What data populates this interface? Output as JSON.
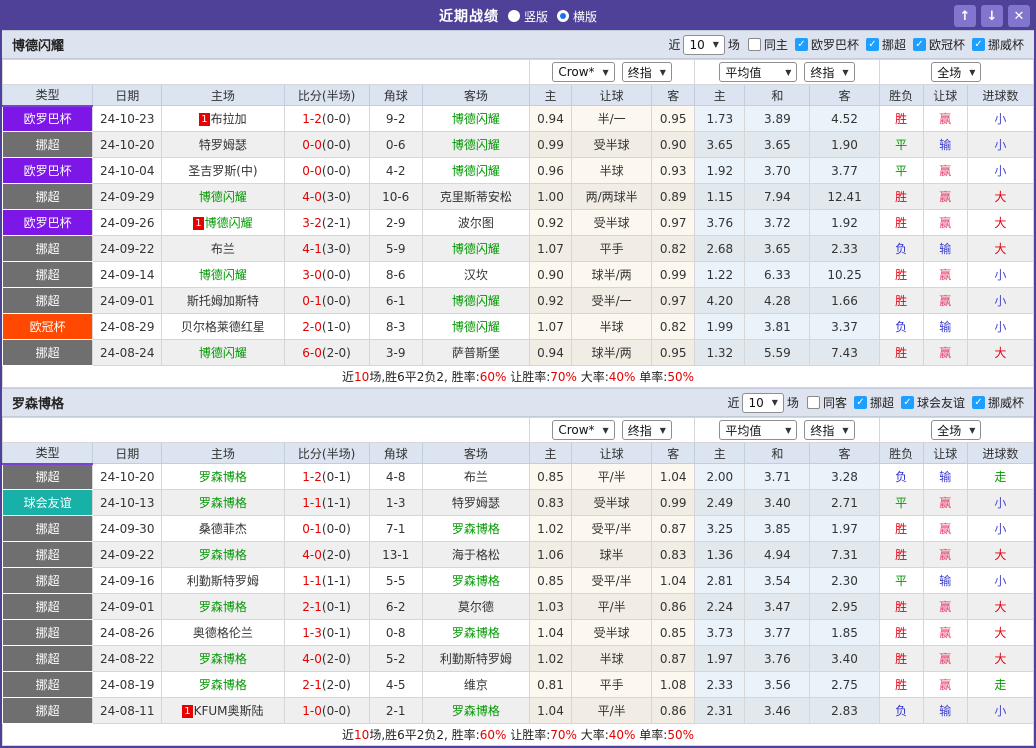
{
  "titlebar": {
    "title": "近期战绩",
    "radio_vertical": "竖版",
    "radio_horizontal": "横版",
    "selected_layout": "横版"
  },
  "icons": {
    "up": "↑",
    "down": "↓",
    "close": "✕",
    "check": "✓",
    "caret": "▼"
  },
  "colors": {
    "titlebar_bg": "#4e4197",
    "button_bg": "#8175ce",
    "checkbox_blue": "#1e9fff",
    "team_green": "#009900",
    "score_red": "#e60000"
  },
  "league_colors": {
    "欧罗巴杯": "#7d17e8",
    "挪超": "#6f6f6f",
    "欧冠杯": "#ff4800",
    "球会友谊": "#17b1a7"
  },
  "result_colors": {
    "胜": "#e60012",
    "平": "#009900",
    "负": "#2f2fd0",
    "赢": "#e83e6c",
    "输": "#3a3ad0",
    "大": "#e60012",
    "小": "#4a4ad0",
    "走": "#009900"
  },
  "columns": [
    "类型",
    "日期",
    "主场",
    "比分(半场)",
    "角球",
    "客场",
    "主",
    "让球",
    "客",
    "主",
    "和",
    "客",
    "胜负",
    "让球",
    "进球数"
  ],
  "dropdowns": {
    "crow": "Crow*",
    "crow_final": "终指",
    "avg": "平均值",
    "avg_final": "终指",
    "scope": "全场"
  },
  "sections": [
    {
      "team": "博德闪耀",
      "filters": {
        "near": "近",
        "count": "10",
        "games": "场",
        "same": {
          "label": "同主",
          "checked": false
        },
        "leagues": [
          "欧罗巴杯",
          "挪超",
          "欧冠杯",
          "挪威杯"
        ]
      },
      "rows": [
        {
          "league": "欧罗巴杯",
          "date": "24-10-23",
          "home": "布拉加",
          "home_rank": "1",
          "home_green": false,
          "score": "1-2",
          "half": "(0-0)",
          "corners": "9-2",
          "away": "博德闪耀",
          "away_green": true,
          "crow": [
            "0.94",
            "半/一",
            "0.95"
          ],
          "avg": [
            "1.73",
            "3.89",
            "4.52"
          ],
          "outcome": [
            "胜",
            "赢",
            "小"
          ]
        },
        {
          "league": "挪超",
          "date": "24-10-20",
          "home": "特罗姆瑟",
          "home_rank": "",
          "home_green": false,
          "score": "0-0",
          "half": "(0-0)",
          "corners": "0-6",
          "away": "博德闪耀",
          "away_green": true,
          "crow": [
            "0.99",
            "受半球",
            "0.90"
          ],
          "avg": [
            "3.65",
            "3.65",
            "1.90"
          ],
          "outcome": [
            "平",
            "输",
            "小"
          ]
        },
        {
          "league": "欧罗巴杯",
          "date": "24-10-04",
          "home": "圣吉罗斯(中)",
          "home_rank": "",
          "home_green": false,
          "score": "0-0",
          "half": "(0-0)",
          "corners": "4-2",
          "away": "博德闪耀",
          "away_green": true,
          "crow": [
            "0.96",
            "半球",
            "0.93"
          ],
          "avg": [
            "1.92",
            "3.70",
            "3.77"
          ],
          "outcome": [
            "平",
            "赢",
            "小"
          ]
        },
        {
          "league": "挪超",
          "date": "24-09-29",
          "home": "博德闪耀",
          "home_rank": "",
          "home_green": true,
          "score": "4-0",
          "half": "(3-0)",
          "corners": "10-6",
          "away": "克里斯蒂安松",
          "away_green": false,
          "crow": [
            "1.00",
            "两/两球半",
            "0.89"
          ],
          "avg": [
            "1.15",
            "7.94",
            "12.41"
          ],
          "outcome": [
            "胜",
            "赢",
            "大"
          ]
        },
        {
          "league": "欧罗巴杯",
          "date": "24-09-26",
          "home": "博德闪耀",
          "home_rank": "1",
          "home_green": true,
          "score": "3-2",
          "half": "(2-1)",
          "corners": "2-9",
          "away": "波尔图",
          "away_green": false,
          "crow": [
            "0.92",
            "受半球",
            "0.97"
          ],
          "avg": [
            "3.76",
            "3.72",
            "1.92"
          ],
          "outcome": [
            "胜",
            "赢",
            "大"
          ]
        },
        {
          "league": "挪超",
          "date": "24-09-22",
          "home": "布兰",
          "home_rank": "",
          "home_green": false,
          "score": "4-1",
          "half": "(3-0)",
          "corners": "5-9",
          "away": "博德闪耀",
          "away_green": true,
          "crow": [
            "1.07",
            "平手",
            "0.82"
          ],
          "avg": [
            "2.68",
            "3.65",
            "2.33"
          ],
          "outcome": [
            "负",
            "输",
            "大"
          ]
        },
        {
          "league": "挪超",
          "date": "24-09-14",
          "home": "博德闪耀",
          "home_rank": "",
          "home_green": true,
          "score": "3-0",
          "half": "(0-0)",
          "corners": "8-6",
          "away": "汉坎",
          "away_green": false,
          "crow": [
            "0.90",
            "球半/两",
            "0.99"
          ],
          "avg": [
            "1.22",
            "6.33",
            "10.25"
          ],
          "outcome": [
            "胜",
            "赢",
            "小"
          ]
        },
        {
          "league": "挪超",
          "date": "24-09-01",
          "home": "斯托姆加斯特",
          "home_rank": "",
          "home_green": false,
          "score": "0-1",
          "half": "(0-0)",
          "corners": "6-1",
          "away": "博德闪耀",
          "away_green": true,
          "crow": [
            "0.92",
            "受半/一",
            "0.97"
          ],
          "avg": [
            "4.20",
            "4.28",
            "1.66"
          ],
          "outcome": [
            "胜",
            "赢",
            "小"
          ]
        },
        {
          "league": "欧冠杯",
          "date": "24-08-29",
          "home": "贝尔格莱德红星",
          "home_rank": "",
          "home_green": false,
          "score": "2-0",
          "half": "(1-0)",
          "corners": "8-3",
          "away": "博德闪耀",
          "away_green": true,
          "crow": [
            "1.07",
            "半球",
            "0.82"
          ],
          "avg": [
            "1.99",
            "3.81",
            "3.37"
          ],
          "outcome": [
            "负",
            "输",
            "小"
          ]
        },
        {
          "league": "挪超",
          "date": "24-08-24",
          "home": "博德闪耀",
          "home_rank": "",
          "home_green": true,
          "score": "6-0",
          "half": "(2-0)",
          "corners": "3-9",
          "away": "萨普斯堡",
          "away_green": false,
          "crow": [
            "0.94",
            "球半/两",
            "0.95"
          ],
          "avg": [
            "1.32",
            "5.59",
            "7.43"
          ],
          "outcome": [
            "胜",
            "赢",
            "大"
          ]
        }
      ],
      "summary": [
        {
          "t": "近"
        },
        {
          "t": "10",
          "red": true
        },
        {
          "t": "场,胜6平2负2, 胜率:"
        },
        {
          "t": "60%",
          "red": true
        },
        {
          "t": " 让胜率:"
        },
        {
          "t": "70%",
          "red": true
        },
        {
          "t": " 大率:"
        },
        {
          "t": "40%",
          "red": true
        },
        {
          "t": " 单率:"
        },
        {
          "t": "50%",
          "red": true
        }
      ]
    },
    {
      "team": "罗森博格",
      "filters": {
        "near": "近",
        "count": "10",
        "games": "场",
        "same": {
          "label": "同客",
          "checked": false
        },
        "leagues": [
          "挪超",
          "球会友谊",
          "挪威杯"
        ]
      },
      "rows": [
        {
          "league": "挪超",
          "date": "24-10-20",
          "home": "罗森博格",
          "home_rank": "",
          "home_green": true,
          "score": "1-2",
          "half": "(0-1)",
          "corners": "4-8",
          "away": "布兰",
          "away_green": false,
          "crow": [
            "0.85",
            "平/半",
            "1.04"
          ],
          "avg": [
            "2.00",
            "3.71",
            "3.28"
          ],
          "outcome": [
            "负",
            "输",
            "走"
          ]
        },
        {
          "league": "球会友谊",
          "date": "24-10-13",
          "home": "罗森博格",
          "home_rank": "",
          "home_green": true,
          "score": "1-1",
          "half": "(1-1)",
          "corners": "1-3",
          "away": "特罗姆瑟",
          "away_green": false,
          "crow": [
            "0.83",
            "受半球",
            "0.99"
          ],
          "avg": [
            "2.49",
            "3.40",
            "2.71"
          ],
          "outcome": [
            "平",
            "赢",
            "小"
          ]
        },
        {
          "league": "挪超",
          "date": "24-09-30",
          "home": "桑德菲杰",
          "home_rank": "",
          "home_green": false,
          "score": "0-1",
          "half": "(0-0)",
          "corners": "7-1",
          "away": "罗森博格",
          "away_green": true,
          "crow": [
            "1.02",
            "受平/半",
            "0.87"
          ],
          "avg": [
            "3.25",
            "3.85",
            "1.97"
          ],
          "outcome": [
            "胜",
            "赢",
            "小"
          ]
        },
        {
          "league": "挪超",
          "date": "24-09-22",
          "home": "罗森博格",
          "home_rank": "",
          "home_green": true,
          "score": "4-0",
          "half": "(2-0)",
          "corners": "13-1",
          "away": "海于格松",
          "away_green": false,
          "crow": [
            "1.06",
            "球半",
            "0.83"
          ],
          "avg": [
            "1.36",
            "4.94",
            "7.31"
          ],
          "outcome": [
            "胜",
            "赢",
            "大"
          ]
        },
        {
          "league": "挪超",
          "date": "24-09-16",
          "home": "利勤斯特罗姆",
          "home_rank": "",
          "home_green": false,
          "score": "1-1",
          "half": "(1-1)",
          "corners": "5-5",
          "away": "罗森博格",
          "away_green": true,
          "crow": [
            "0.85",
            "受平/半",
            "1.04"
          ],
          "avg": [
            "2.81",
            "3.54",
            "2.30"
          ],
          "outcome": [
            "平",
            "输",
            "小"
          ]
        },
        {
          "league": "挪超",
          "date": "24-09-01",
          "home": "罗森博格",
          "home_rank": "",
          "home_green": true,
          "score": "2-1",
          "half": "(0-1)",
          "corners": "6-2",
          "away": "莫尔德",
          "away_green": false,
          "crow": [
            "1.03",
            "平/半",
            "0.86"
          ],
          "avg": [
            "2.24",
            "3.47",
            "2.95"
          ],
          "outcome": [
            "胜",
            "赢",
            "大"
          ]
        },
        {
          "league": "挪超",
          "date": "24-08-26",
          "home": "奥德格伦兰",
          "home_rank": "",
          "home_green": false,
          "score": "1-3",
          "half": "(0-1)",
          "corners": "0-8",
          "away": "罗森博格",
          "away_green": true,
          "crow": [
            "1.04",
            "受半球",
            "0.85"
          ],
          "avg": [
            "3.73",
            "3.77",
            "1.85"
          ],
          "outcome": [
            "胜",
            "赢",
            "大"
          ]
        },
        {
          "league": "挪超",
          "date": "24-08-22",
          "home": "罗森博格",
          "home_rank": "",
          "home_green": true,
          "score": "4-0",
          "half": "(2-0)",
          "corners": "5-2",
          "away": "利勤斯特罗姆",
          "away_green": false,
          "crow": [
            "1.02",
            "半球",
            "0.87"
          ],
          "avg": [
            "1.97",
            "3.76",
            "3.40"
          ],
          "outcome": [
            "胜",
            "赢",
            "大"
          ]
        },
        {
          "league": "挪超",
          "date": "24-08-19",
          "home": "罗森博格",
          "home_rank": "",
          "home_green": true,
          "score": "2-1",
          "half": "(2-0)",
          "corners": "4-5",
          "away": "维京",
          "away_green": false,
          "crow": [
            "0.81",
            "平手",
            "1.08"
          ],
          "avg": [
            "2.33",
            "3.56",
            "2.75"
          ],
          "outcome": [
            "胜",
            "赢",
            "走"
          ]
        },
        {
          "league": "挪超",
          "date": "24-08-11",
          "home": "KFUM奥斯陆",
          "home_rank": "1",
          "home_green": false,
          "score": "1-0",
          "half": "(0-0)",
          "corners": "2-1",
          "away": "罗森博格",
          "away_green": true,
          "crow": [
            "1.04",
            "平/半",
            "0.86"
          ],
          "avg": [
            "2.31",
            "3.46",
            "2.83"
          ],
          "outcome": [
            "负",
            "输",
            "小"
          ]
        }
      ],
      "summary": [
        {
          "t": "近"
        },
        {
          "t": "10",
          "red": true
        },
        {
          "t": "场,胜6平2负2, 胜率:"
        },
        {
          "t": "60%",
          "red": true
        },
        {
          "t": " 让胜率:"
        },
        {
          "t": "70%",
          "red": true
        },
        {
          "t": " 大率:"
        },
        {
          "t": "40%",
          "red": true
        },
        {
          "t": " 单率:"
        },
        {
          "t": "50%",
          "red": true
        }
      ]
    }
  ]
}
